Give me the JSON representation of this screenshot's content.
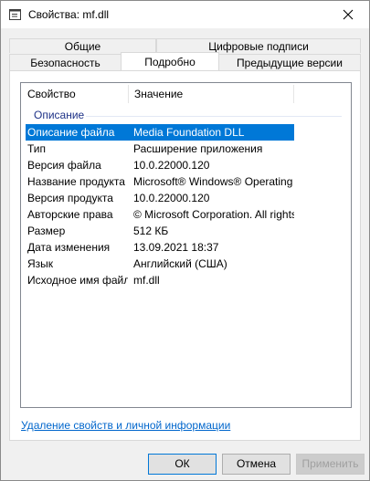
{
  "window": {
    "title": "Свойства: mf.dll"
  },
  "tabs": {
    "row1": [
      "Общие",
      "Цифровые подписи"
    ],
    "row2": [
      "Безопасность",
      "Подробно",
      "Предыдущие версии"
    ],
    "active": "Подробно"
  },
  "details": {
    "col_property": "Свойство",
    "col_value": "Значение",
    "group": "Описание",
    "rows": [
      {
        "name": "Описание файла",
        "value": "Media Foundation DLL"
      },
      {
        "name": "Тип",
        "value": "Расширение приложения"
      },
      {
        "name": "Версия файла",
        "value": "10.0.22000.120"
      },
      {
        "name": "Название продукта",
        "value": "Microsoft® Windows® Operating ..."
      },
      {
        "name": "Версия продукта",
        "value": "10.0.22000.120"
      },
      {
        "name": "Авторские права",
        "value": "© Microsoft Corporation. All rights ..."
      },
      {
        "name": "Размер",
        "value": "512 КБ"
      },
      {
        "name": "Дата изменения",
        "value": "13.09.2021 18:37"
      },
      {
        "name": "Язык",
        "value": "Английский (США)"
      },
      {
        "name": "Исходное имя файла",
        "value": "mf.dll"
      }
    ],
    "selected_row": "Описание файла"
  },
  "link": "Удаление свойств и личной информации",
  "buttons": {
    "ok": "ОК",
    "cancel": "Отмена",
    "apply": "Применить"
  },
  "colors": {
    "selection": "#0078d7",
    "group_label": "#1e3287",
    "link": "#0066cc"
  }
}
